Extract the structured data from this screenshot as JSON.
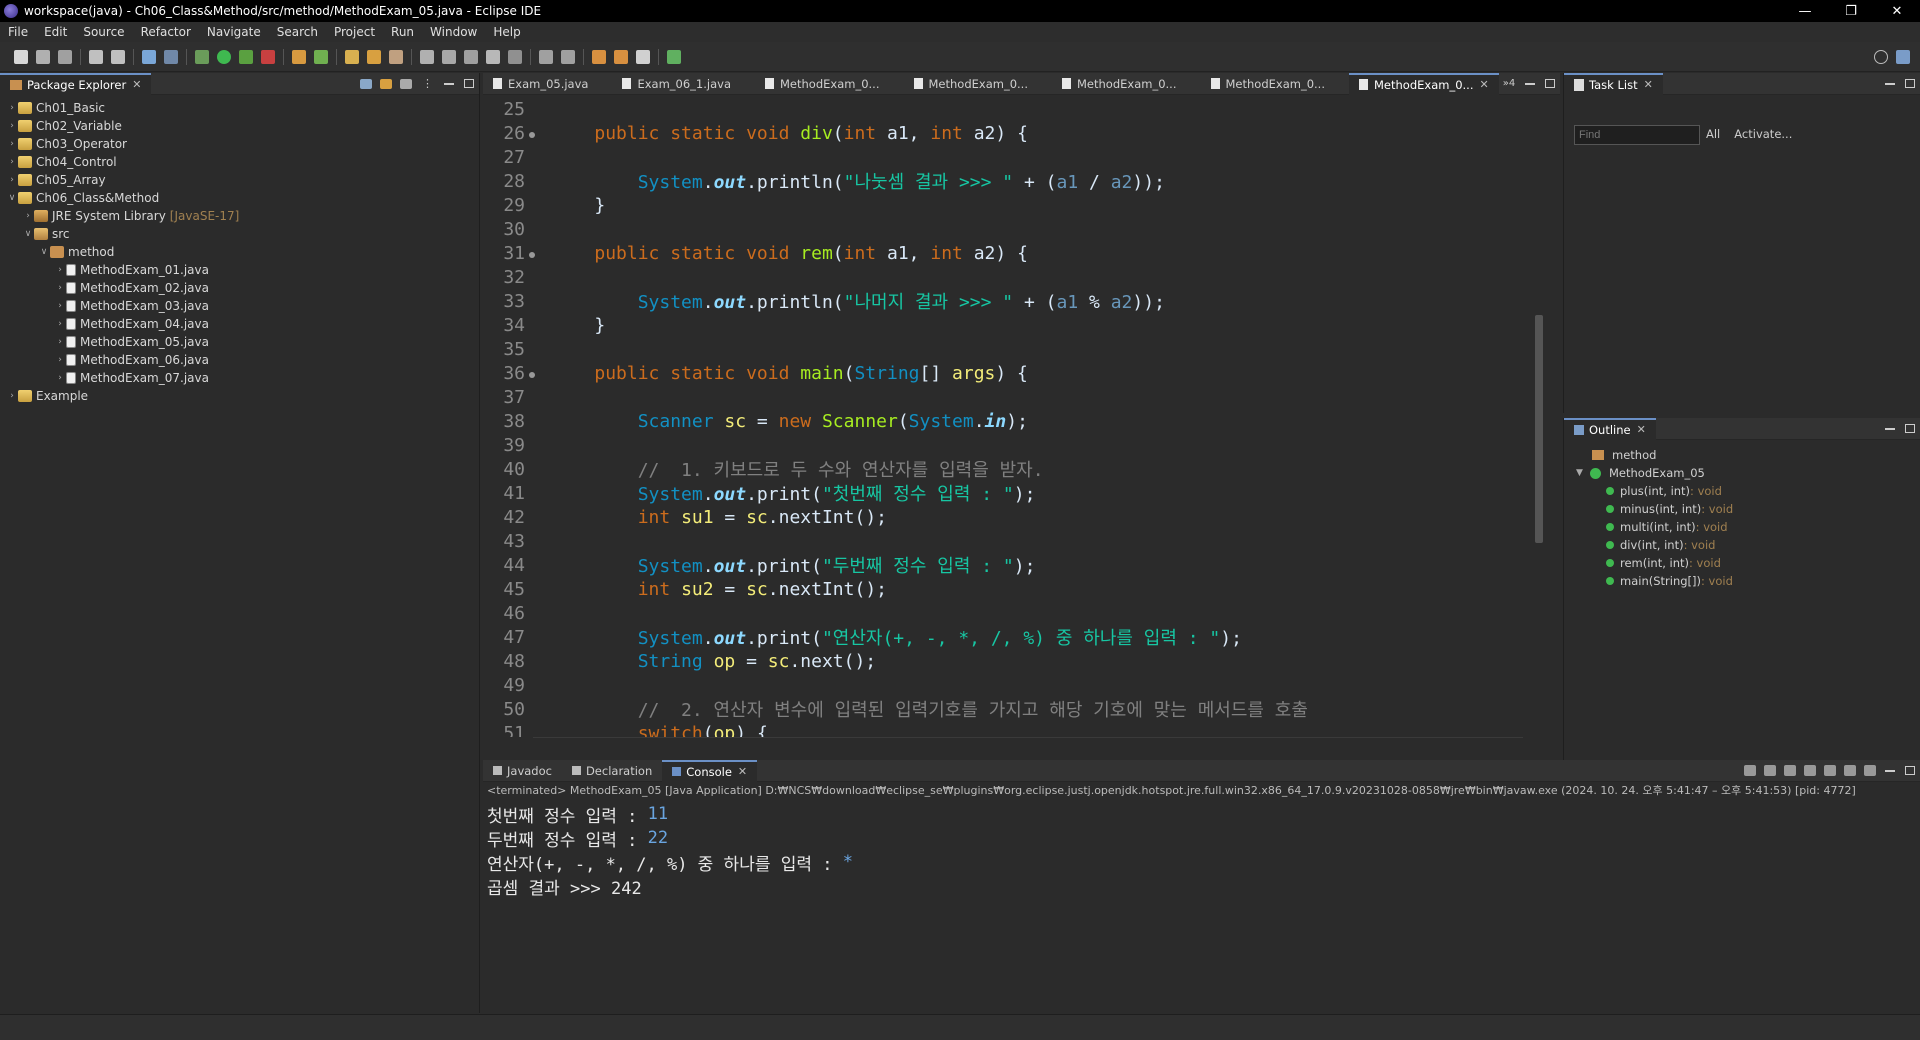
{
  "window": {
    "title": "workspace(java) - Ch06_Class&Method/src/method/MethodExam_05.java - Eclipse IDE"
  },
  "menu": [
    "File",
    "Edit",
    "Source",
    "Refactor",
    "Navigate",
    "Search",
    "Project",
    "Run",
    "Window",
    "Help"
  ],
  "package_explorer": {
    "title": "Package Explorer",
    "items": [
      {
        "label": "Ch01_Basic",
        "depth": 0,
        "type": "project",
        "expanded": false
      },
      {
        "label": "Ch02_Variable",
        "depth": 0,
        "type": "project",
        "expanded": false
      },
      {
        "label": "Ch03_Operator",
        "depth": 0,
        "type": "project",
        "expanded": false
      },
      {
        "label": "Ch04_Control",
        "depth": 0,
        "type": "project",
        "expanded": false
      },
      {
        "label": "Ch05_Array",
        "depth": 0,
        "type": "project",
        "expanded": false
      },
      {
        "label": "Ch06_Class&Method",
        "depth": 0,
        "type": "project",
        "expanded": true
      },
      {
        "label": "JRE System Library",
        "extra": "[JavaSE-17]",
        "depth": 1,
        "type": "jre",
        "expanded": false
      },
      {
        "label": "src",
        "depth": 1,
        "type": "src",
        "expanded": true
      },
      {
        "label": "method",
        "depth": 2,
        "type": "pkg",
        "expanded": true
      },
      {
        "label": "MethodExam_01.java",
        "depth": 3,
        "type": "file",
        "expanded": false
      },
      {
        "label": "MethodExam_02.java",
        "depth": 3,
        "type": "file",
        "expanded": false
      },
      {
        "label": "MethodExam_03.java",
        "depth": 3,
        "type": "file",
        "expanded": false
      },
      {
        "label": "MethodExam_04.java",
        "depth": 3,
        "type": "file",
        "expanded": false
      },
      {
        "label": "MethodExam_05.java",
        "depth": 3,
        "type": "file",
        "expanded": false
      },
      {
        "label": "MethodExam_06.java",
        "depth": 3,
        "type": "file",
        "expanded": false
      },
      {
        "label": "MethodExam_07.java",
        "depth": 3,
        "type": "file",
        "expanded": false
      },
      {
        "label": "Example",
        "depth": 0,
        "type": "project",
        "expanded": false
      }
    ]
  },
  "editor": {
    "tabs": [
      {
        "label": "Exam_05.java",
        "active": false
      },
      {
        "label": "Exam_06_1.java",
        "active": false
      },
      {
        "label": "MethodExam_0...",
        "active": false
      },
      {
        "label": "MethodExam_0...",
        "active": false
      },
      {
        "label": "MethodExam_0...",
        "active": false
      },
      {
        "label": "MethodExam_0...",
        "active": false
      },
      {
        "label": "MethodExam_0...",
        "active": true
      }
    ],
    "overflow_count": "4",
    "lines": [
      {
        "n": "25",
        "marker": false,
        "tokens": []
      },
      {
        "n": "26",
        "marker": true,
        "tokens": [
          [
            "    ",
            ""
          ],
          [
            "public static void ",
            "kw"
          ],
          [
            "div",
            "fn"
          ],
          [
            "(",
            ""
          ],
          [
            "int ",
            "kw"
          ],
          [
            "a1",
            ""
          ],
          [
            ", ",
            ""
          ],
          [
            "int ",
            "kw"
          ],
          [
            "a2",
            ""
          ],
          [
            ") {",
            ""
          ]
        ]
      },
      {
        "n": "27",
        "marker": false,
        "tokens": []
      },
      {
        "n": "28",
        "marker": false,
        "tokens": [
          [
            "        ",
            ""
          ],
          [
            "System",
            "ty"
          ],
          [
            ".",
            ""
          ],
          [
            "out",
            "it"
          ],
          [
            ".println(",
            ""
          ],
          [
            "\"나눗셈 결과 >>> \"",
            "st"
          ],
          [
            " + (",
            ""
          ],
          [
            "a1",
            "nm"
          ],
          [
            " / ",
            ""
          ],
          [
            "a2",
            "nm"
          ],
          [
            "));",
            ""
          ]
        ]
      },
      {
        "n": "29",
        "marker": false,
        "tokens": [
          [
            "    }",
            ""
          ]
        ]
      },
      {
        "n": "30",
        "marker": false,
        "tokens": []
      },
      {
        "n": "31",
        "marker": true,
        "tokens": [
          [
            "    ",
            ""
          ],
          [
            "public static void ",
            "kw"
          ],
          [
            "rem",
            "fn"
          ],
          [
            "(",
            ""
          ],
          [
            "int ",
            "kw"
          ],
          [
            "a1",
            ""
          ],
          [
            ", ",
            ""
          ],
          [
            "int ",
            "kw"
          ],
          [
            "a2",
            ""
          ],
          [
            ") {",
            ""
          ]
        ]
      },
      {
        "n": "32",
        "marker": false,
        "tokens": []
      },
      {
        "n": "33",
        "marker": false,
        "tokens": [
          [
            "        ",
            ""
          ],
          [
            "System",
            "ty"
          ],
          [
            ".",
            ""
          ],
          [
            "out",
            "it"
          ],
          [
            ".println(",
            ""
          ],
          [
            "\"나머지 결과 >>> \"",
            "st"
          ],
          [
            " + (",
            ""
          ],
          [
            "a1",
            "nm"
          ],
          [
            " % ",
            ""
          ],
          [
            "a2",
            "nm"
          ],
          [
            "));",
            ""
          ]
        ]
      },
      {
        "n": "34",
        "marker": false,
        "tokens": [
          [
            "    }",
            ""
          ]
        ]
      },
      {
        "n": "35",
        "marker": false,
        "tokens": []
      },
      {
        "n": "36",
        "marker": true,
        "tokens": [
          [
            "    ",
            ""
          ],
          [
            "public static void ",
            "kw"
          ],
          [
            "main",
            "fn"
          ],
          [
            "(",
            ""
          ],
          [
            "String",
            "ty"
          ],
          [
            "[] ",
            ""
          ],
          [
            "args",
            "vr"
          ],
          [
            ") {",
            ""
          ]
        ]
      },
      {
        "n": "37",
        "marker": false,
        "tokens": []
      },
      {
        "n": "38",
        "marker": false,
        "tokens": [
          [
            "        ",
            ""
          ],
          [
            "Scanner ",
            "ty"
          ],
          [
            "sc",
            "vr"
          ],
          [
            " = ",
            ""
          ],
          [
            "new ",
            "kw"
          ],
          [
            "Scanner",
            "fn"
          ],
          [
            "(",
            ""
          ],
          [
            "System",
            "ty"
          ],
          [
            ".",
            ""
          ],
          [
            "in",
            "it"
          ],
          [
            ");",
            ""
          ]
        ]
      },
      {
        "n": "39",
        "marker": false,
        "tokens": []
      },
      {
        "n": "40",
        "marker": false,
        "tokens": [
          [
            "        ",
            ""
          ],
          [
            "//  1. 키보드로 두 수와 연산자를 입력을 받자.",
            "cm"
          ]
        ]
      },
      {
        "n": "41",
        "marker": false,
        "tokens": [
          [
            "        ",
            ""
          ],
          [
            "System",
            "ty"
          ],
          [
            ".",
            ""
          ],
          [
            "out",
            "it"
          ],
          [
            ".print(",
            ""
          ],
          [
            "\"첫번째 정수 입력 : \"",
            "st"
          ],
          [
            ");",
            ""
          ]
        ]
      },
      {
        "n": "42",
        "marker": false,
        "tokens": [
          [
            "        ",
            ""
          ],
          [
            "int ",
            "kw"
          ],
          [
            "su1",
            "vr"
          ],
          [
            " = ",
            ""
          ],
          [
            "sc",
            "vr"
          ],
          [
            ".nextInt();",
            ""
          ]
        ]
      },
      {
        "n": "43",
        "marker": false,
        "tokens": []
      },
      {
        "n": "44",
        "marker": false,
        "tokens": [
          [
            "        ",
            ""
          ],
          [
            "System",
            "ty"
          ],
          [
            ".",
            ""
          ],
          [
            "out",
            "it"
          ],
          [
            ".print(",
            ""
          ],
          [
            "\"두번째 정수 입력 : \"",
            "st"
          ],
          [
            ");",
            ""
          ]
        ]
      },
      {
        "n": "45",
        "marker": false,
        "tokens": [
          [
            "        ",
            ""
          ],
          [
            "int ",
            "kw"
          ],
          [
            "su2",
            "vr"
          ],
          [
            " = ",
            ""
          ],
          [
            "sc",
            "vr"
          ],
          [
            ".nextInt();",
            ""
          ]
        ]
      },
      {
        "n": "46",
        "marker": false,
        "tokens": []
      },
      {
        "n": "47",
        "marker": false,
        "tokens": [
          [
            "        ",
            ""
          ],
          [
            "System",
            "ty"
          ],
          [
            ".",
            ""
          ],
          [
            "out",
            "it"
          ],
          [
            ".print(",
            ""
          ],
          [
            "\"연산자(+, -, *, /, %) 중 하나를 입력 : \"",
            "st"
          ],
          [
            ");",
            ""
          ]
        ]
      },
      {
        "n": "48",
        "marker": false,
        "tokens": [
          [
            "        ",
            ""
          ],
          [
            "String ",
            "ty"
          ],
          [
            "op",
            "vr"
          ],
          [
            " = ",
            ""
          ],
          [
            "sc",
            "vr"
          ],
          [
            ".next();",
            ""
          ]
        ]
      },
      {
        "n": "49",
        "marker": false,
        "tokens": []
      },
      {
        "n": "50",
        "marker": false,
        "tokens": [
          [
            "        ",
            ""
          ],
          [
            "//  2. 연산자 변수에 입력된 입력기호를 가지고 해당 기호에 맞는 메서드를 호출",
            "cm"
          ]
        ]
      },
      {
        "n": "51",
        "marker": false,
        "tokens": [
          [
            "        ",
            ""
          ],
          [
            "switch",
            "kw"
          ],
          [
            "(",
            ""
          ],
          [
            "op",
            "vr"
          ],
          [
            ") {",
            ""
          ]
        ]
      }
    ]
  },
  "tasks": {
    "title": "Task List",
    "find_placeholder": "Find",
    "all_label": "All",
    "activate_label": "Activate..."
  },
  "outline": {
    "title": "Outline",
    "package": "method",
    "class": "MethodExam_05",
    "members": [
      {
        "name": "plus(int, int)",
        "ret": " : void"
      },
      {
        "name": "minus(int, int)",
        "ret": " : void"
      },
      {
        "name": "multi(int, int)",
        "ret": " : void"
      },
      {
        "name": "div(int, int)",
        "ret": " : void"
      },
      {
        "name": "rem(int, int)",
        "ret": " : void"
      },
      {
        "name": "main(String[])",
        "ret": " : void"
      }
    ]
  },
  "console": {
    "tabs": [
      {
        "label": "Javadoc",
        "active": false
      },
      {
        "label": "Declaration",
        "active": false
      },
      {
        "label": "Console",
        "active": true
      }
    ],
    "info": "<terminated> MethodExam_05 [Java Application] D:₩NCS₩download₩eclipse_se₩plugins₩org.eclipse.justj.openjdk.hotspot.jre.full.win32.x86_64_17.0.9.v20231028-0858₩jre₩bin₩javaw.exe  (2024. 10. 24. 오후 5:41:47 – 오후 5:41:53) [pid: 4772]",
    "lines": [
      {
        "prompt": "첫번째 정수 입력 : ",
        "input": "11"
      },
      {
        "prompt": "두번째 정수 입력 : ",
        "input": "22"
      },
      {
        "prompt": "연산자(+, -, *, /, %) 중 하나를 입력 : ",
        "input": "*"
      },
      {
        "prompt": "곱셈 결과 >>> 242",
        "input": ""
      }
    ]
  }
}
